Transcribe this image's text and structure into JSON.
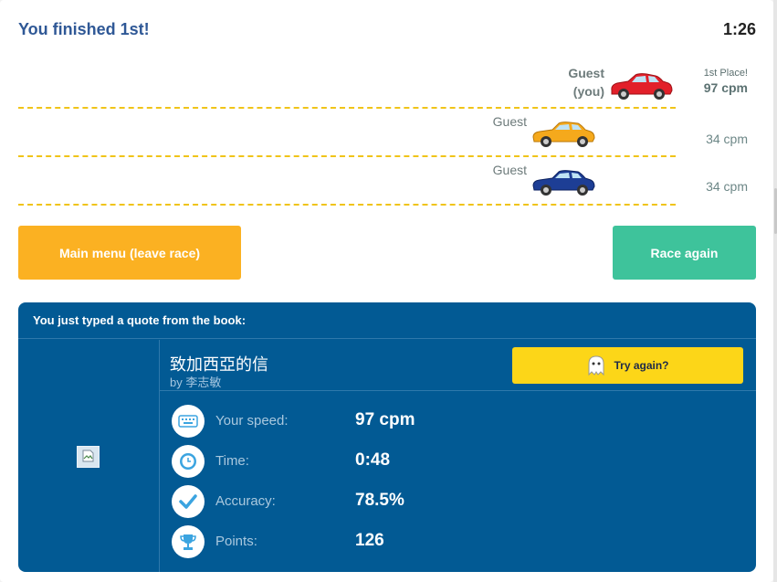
{
  "header": {
    "status": "You finished 1st!",
    "timer": "1:26"
  },
  "race": {
    "lanes": [
      {
        "name": "Guest",
        "tag": "(you)",
        "place": "1st Place!",
        "speed": "97 cpm",
        "car_color": "#e2202a"
      },
      {
        "name": "Guest",
        "speed": "34 cpm",
        "car_color": "#f5a91c"
      },
      {
        "name": "Guest",
        "speed": "34 cpm",
        "car_color": "#1d3e95"
      }
    ]
  },
  "buttons": {
    "main_menu": "Main menu (leave race)",
    "race_again": "Race again"
  },
  "quote": {
    "header": "You just typed a quote from the book:",
    "book_title": "致加西亞的信",
    "author": "by 李志敏",
    "try_again": "Try again?",
    "stats": [
      {
        "icon": "keyboard-icon",
        "label": "Your speed:",
        "value": "97 cpm"
      },
      {
        "icon": "clock-icon",
        "label": "Time:",
        "value": "0:48"
      },
      {
        "icon": "check-icon",
        "label": "Accuracy:",
        "value": "78.5%"
      },
      {
        "icon": "trophy-icon",
        "label": "Points:",
        "value": "126"
      }
    ]
  },
  "colors": {
    "accent_title": "#2f5896",
    "menu_button": "#fbb122",
    "race_again_button": "#3ec39b",
    "quote_panel": "#025a94",
    "try_again_button": "#fcd618",
    "icon_blue": "#3ba4e0"
  }
}
